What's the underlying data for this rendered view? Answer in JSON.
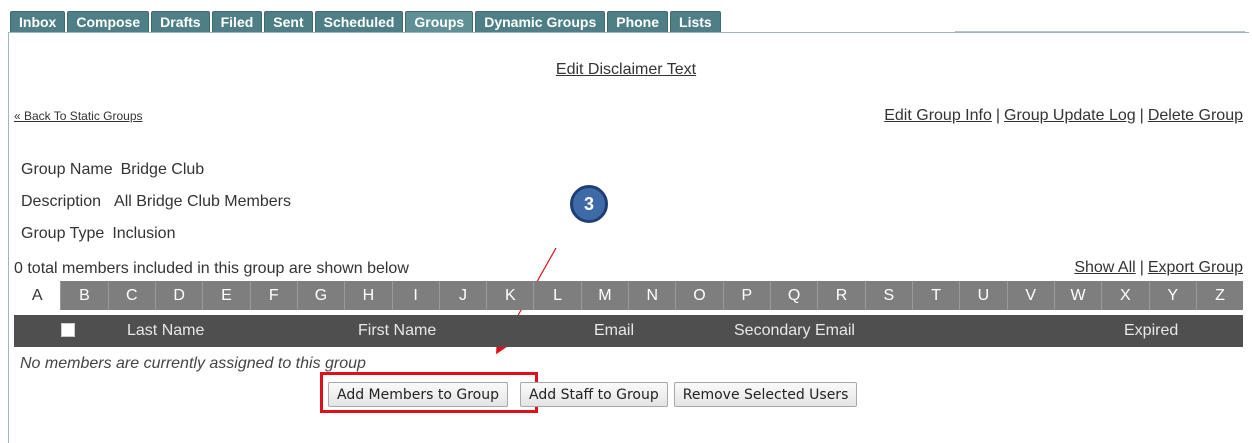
{
  "tabs": [
    {
      "label": "Inbox"
    },
    {
      "label": "Compose"
    },
    {
      "label": "Drafts"
    },
    {
      "label": "Filed"
    },
    {
      "label": "Sent"
    },
    {
      "label": "Scheduled"
    },
    {
      "label": "Groups"
    },
    {
      "label": "Dynamic Groups"
    },
    {
      "label": "Phone"
    },
    {
      "label": "Lists"
    }
  ],
  "header": {
    "edit_disclaimer": "Edit Disclaimer Text",
    "back_link": "« Back To Static Groups",
    "edit_group_info": "Edit Group Info",
    "group_update_log": "Group Update Log",
    "delete_group": "Delete Group",
    "separator": "|"
  },
  "group": {
    "name_label": "Group Name",
    "name_value": "Bridge Club",
    "description_label": "Description",
    "description_value": "All Bridge Club Members",
    "type_label": "Group Type",
    "type_value": "Inclusion"
  },
  "members": {
    "count_text": "0 total members included in this group are shown below",
    "show_all": "Show All",
    "export_group": "Export Group",
    "empty_message": "No members are currently assigned to this group"
  },
  "alphabet": [
    "A",
    "B",
    "C",
    "D",
    "E",
    "F",
    "G",
    "H",
    "I",
    "J",
    "K",
    "L",
    "M",
    "N",
    "O",
    "P",
    "Q",
    "R",
    "S",
    "T",
    "U",
    "V",
    "W",
    "X",
    "Y",
    "Z"
  ],
  "columns": {
    "last_name": "Last Name",
    "first_name": "First Name",
    "email": "Email",
    "secondary_email": "Secondary Email",
    "expired": "Expired"
  },
  "buttons": {
    "add_members": "Add Members to Group",
    "add_staff": "Add Staff to Group",
    "remove_selected": "Remove Selected Users"
  },
  "annotation": {
    "step_number": "3"
  },
  "colors": {
    "tab_bg": "#4f7f86",
    "alpha_bg": "#7e7e7e",
    "header_bg": "#4f4f4f",
    "highlight": "#e0101a",
    "badge": "#3f6aa8"
  }
}
